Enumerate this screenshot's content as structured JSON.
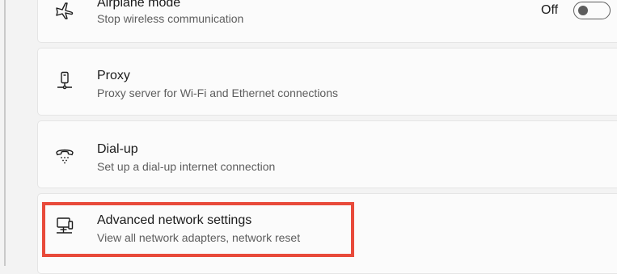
{
  "settings": {
    "items": [
      {
        "title": "Airplane mode",
        "subtitle": "Stop wireless communication",
        "icon": "airplane-icon",
        "toggle": {
          "label": "Off",
          "state": "off"
        }
      },
      {
        "title": "Proxy",
        "subtitle": "Proxy server for Wi-Fi and Ethernet connections",
        "icon": "proxy-icon"
      },
      {
        "title": "Dial-up",
        "subtitle": "Set up a dial-up internet connection",
        "icon": "dialup-phone-icon"
      },
      {
        "title": "Advanced network settings",
        "subtitle": "View all network adapters, network reset",
        "icon": "network-computer-icon"
      }
    ]
  },
  "colors": {
    "highlight": "#e84a3a",
    "background": "#f3f3f3",
    "card": "#fbfbfb"
  }
}
